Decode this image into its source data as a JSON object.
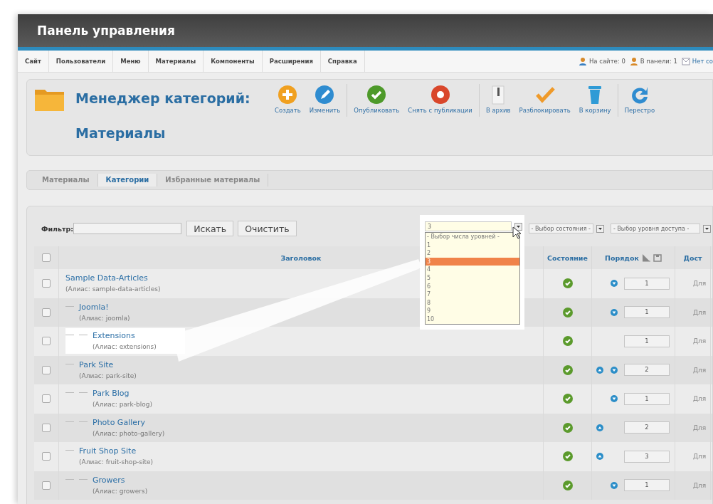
{
  "window": {
    "title": "Панель управления"
  },
  "menu": {
    "items": [
      "Сайт",
      "Пользователи",
      "Меню",
      "Материалы",
      "Компоненты",
      "Расширения",
      "Справка"
    ],
    "status": [
      {
        "kind": "users",
        "text": "На сайте: 0"
      },
      {
        "kind": "admins",
        "text": "В панели: 1"
      },
      {
        "kind": "messages",
        "text": "Нет со"
      }
    ]
  },
  "toolbar": {
    "title": "Менеджер категорий:",
    "subtitle": "Материалы",
    "groups": [
      [
        {
          "kind": "new",
          "label": "Создать"
        },
        {
          "kind": "edit",
          "label": "Изменить"
        }
      ],
      [
        {
          "kind": "publish",
          "label": "Опубликовать"
        },
        {
          "kind": "unpublish",
          "label": "Снять с публикации"
        }
      ],
      [
        {
          "kind": "archive",
          "label": "В архив"
        },
        {
          "kind": "checkin",
          "label": "Разблокировать"
        },
        {
          "kind": "trash",
          "label": "В корзину"
        }
      ],
      [
        {
          "kind": "rebuild",
          "label": "Перестро"
        }
      ]
    ]
  },
  "tabs": [
    {
      "label": "Материалы",
      "selected": false
    },
    {
      "label": "Категории",
      "selected": true
    },
    {
      "label": "Избранные материалы",
      "selected": false
    }
  ],
  "filter": {
    "label": "Фильтр:",
    "search_button": "Искать",
    "clear_button": "Очистить",
    "levels_select": {
      "value": "3",
      "expanded": true,
      "options": [
        {
          "label": "- Выбор числа уровней -",
          "selected": false
        },
        {
          "label": "1",
          "selected": false
        },
        {
          "label": "2",
          "selected": false
        },
        {
          "label": "3",
          "selected": true
        },
        {
          "label": "4",
          "selected": false
        },
        {
          "label": "5",
          "selected": false
        },
        {
          "label": "6",
          "selected": false
        },
        {
          "label": "7",
          "selected": false
        },
        {
          "label": "8",
          "selected": false
        },
        {
          "label": "9",
          "selected": false
        },
        {
          "label": "10",
          "selected": false
        }
      ]
    },
    "state_select": {
      "value": "- Выбор состояния -"
    },
    "access_select": {
      "value": "- Выбор уровня доступа -"
    }
  },
  "table": {
    "columns": [
      {
        "kind": "check",
        "checked": false
      },
      {
        "kind": "text",
        "label": "Заголовок"
      },
      {
        "kind": "text",
        "label": "Состояние"
      },
      {
        "kind": "order",
        "label": "Порядок"
      },
      {
        "kind": "text",
        "label": "Дост"
      }
    ],
    "rows": [
      {
        "checked": false,
        "title": "Sample Data-Articles",
        "alias": "(Алиас: sample-data-articles)",
        "published": true,
        "move_up": false,
        "move_down": true,
        "order": "1",
        "access": "Для",
        "highlighted": false,
        "children": [
          {
            "checked": false,
            "title": "Joomla!",
            "alias": "(Алиас: joomla)",
            "published": true,
            "move_up": false,
            "move_down": true,
            "order": "1",
            "access": "Для",
            "highlighted": false,
            "children": [
              {
                "checked": false,
                "title": "Extensions",
                "alias": "(Алиас: extensions)",
                "published": true,
                "move_up": false,
                "move_down": false,
                "order": "1",
                "access": "Для",
                "highlighted": true
              }
            ]
          },
          {
            "checked": false,
            "title": "Park Site",
            "alias": "(Алиас: park-site)",
            "published": true,
            "move_up": true,
            "move_down": true,
            "order": "2",
            "access": "Для",
            "highlighted": false,
            "children": [
              {
                "checked": false,
                "title": "Park Blog",
                "alias": "(Алиас: park-blog)",
                "published": true,
                "move_up": false,
                "move_down": true,
                "order": "1",
                "access": "Для",
                "highlighted": false
              },
              {
                "checked": false,
                "title": "Photo Gallery",
                "alias": "(Алиас: photo-gallery)",
                "published": true,
                "move_up": true,
                "move_down": false,
                "order": "2",
                "access": "Для",
                "highlighted": false
              }
            ]
          },
          {
            "checked": false,
            "title": "Fruit Shop Site",
            "alias": "(Алиас: fruit-shop-site)",
            "published": true,
            "move_up": true,
            "move_down": false,
            "order": "3",
            "access": "Для",
            "highlighted": false,
            "children": [
              {
                "checked": false,
                "title": "Growers",
                "alias": "(Алиас: growers)",
                "published": true,
                "move_up": false,
                "move_down": true,
                "order": "1",
                "access": "Для",
                "highlighted": false
              }
            ]
          }
        ]
      }
    ]
  }
}
